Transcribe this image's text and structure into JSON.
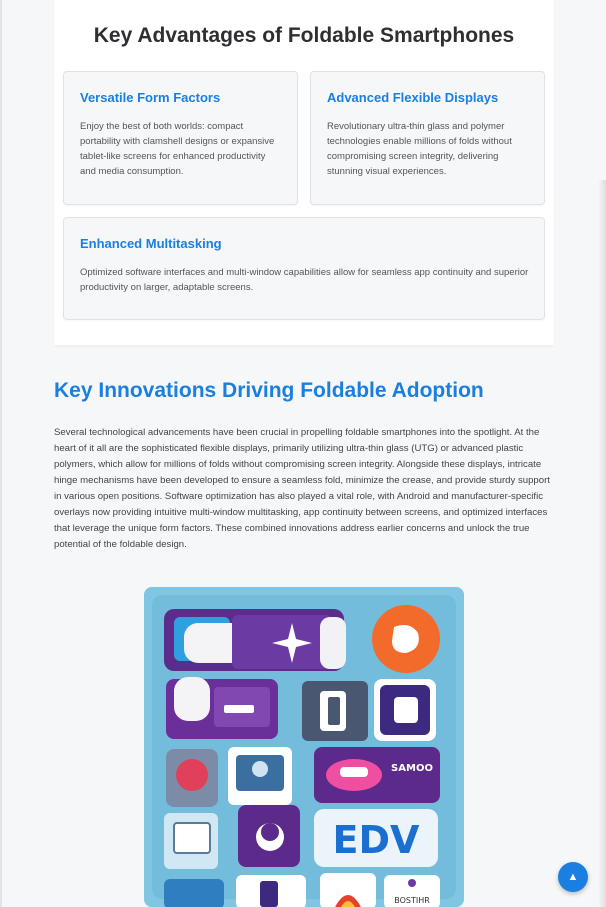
{
  "advantages": {
    "title": "Key Advantages of Foldable Smartphones",
    "items": [
      {
        "heading": "Versatile Form Factors",
        "text": "Enjoy the best of both worlds: compact portability with clamshell designs or expansive tablet-like screens for enhanced productivity and media consumption."
      },
      {
        "heading": "Advanced Flexible Displays",
        "text": "Revolutionary ultra-thin glass and polymer technologies enable millions of folds without compromising screen integrity, delivering stunning visual experiences."
      },
      {
        "heading": "Enhanced Multitasking",
        "text": "Optimized software interfaces and multi-window capabilities allow for seamless app continuity and superior productivity on larger, adaptable screens."
      }
    ]
  },
  "innovations": {
    "title": "Key Innovations Driving Foldable Adoption",
    "body": "Several technological advancements have been crucial in propelling foldable smartphones into the spotlight. At the heart of it all are the sophisticated flexible displays, primarily utilizing ultra-thin glass (UTG) or advanced plastic polymers, which allow for millions of folds without compromising screen integrity. Alongside these displays, intricate hinge mechanisms have been developed to ensure a seamless fold, minimize the crease, and provide sturdy support in various open positions. Software optimization has also played a vital role, with Android and manufacturer-specific overlays now providing intuitive multi-window multitasking, app continuity between screens, and optimized interfaces that leverage the unique form factors. These combined innovations address earlier concerns and unlock the true potential of the foldable design."
  },
  "illustration": {
    "tile_text_1": "EDV",
    "tile_text_2": "SAMOO",
    "tile_text_3": "BOSTIHR"
  },
  "scroll_top": {
    "icon": "▲"
  },
  "colors": {
    "accent": "#1a7fe0",
    "heading": "#2d2f33",
    "illustration_bg": "#7ec3e0"
  }
}
